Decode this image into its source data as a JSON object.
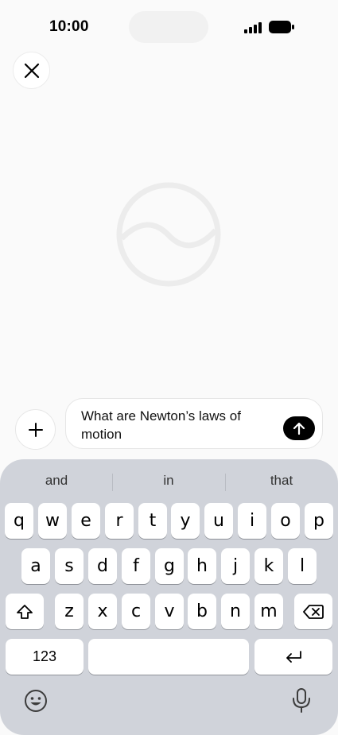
{
  "status": {
    "time": "10:00"
  },
  "composer": {
    "input_text": "What are Newton’s laws of motion"
  },
  "keyboard": {
    "suggestions": [
      "and",
      "in",
      "that"
    ],
    "row1": [
      "q",
      "w",
      "e",
      "r",
      "t",
      "y",
      "u",
      "i",
      "o",
      "p"
    ],
    "row2": [
      "a",
      "s",
      "d",
      "f",
      "g",
      "h",
      "j",
      "k",
      "l"
    ],
    "row3": [
      "z",
      "x",
      "c",
      "v",
      "b",
      "n",
      "m"
    ],
    "numbers_label": "123"
  },
  "icons": {
    "close": "close-icon",
    "plus": "plus-icon",
    "send": "arrow-up-icon",
    "shift": "shift-icon",
    "delete": "backspace-icon",
    "return": "return-icon",
    "emoji": "emoji-icon",
    "mic": "microphone-icon"
  }
}
